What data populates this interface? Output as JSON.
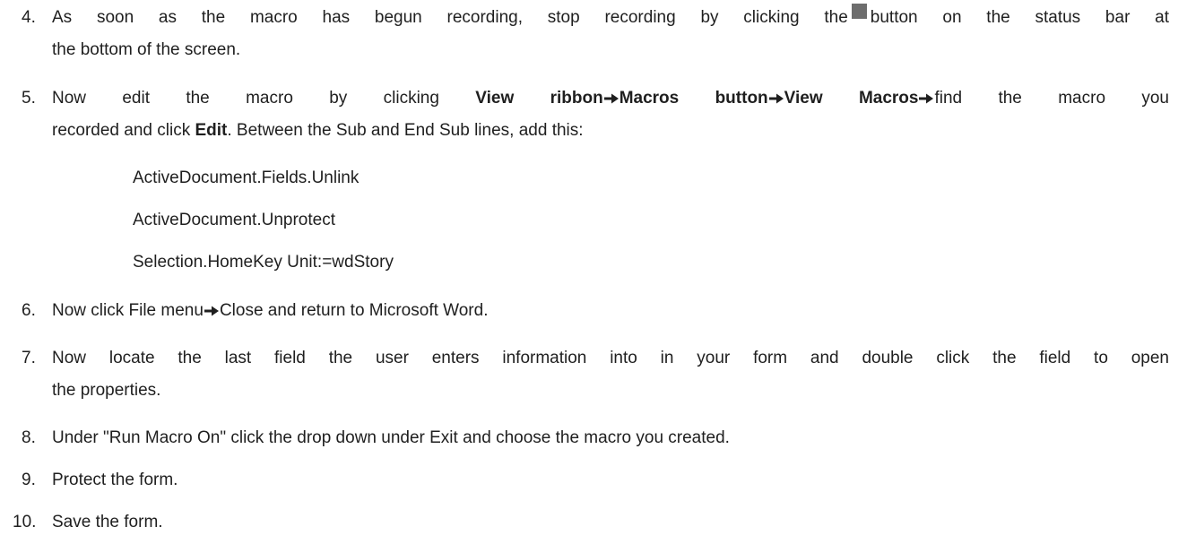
{
  "steps": [
    {
      "number": "4.",
      "line1_a": "As soon as the macro has begun recording, stop recording by clicking the",
      "icon": "stop-square-icon",
      "line1_b": "button on the status bar at",
      "line2": "the bottom of the screen."
    },
    {
      "number": "5.",
      "line1_a": "Now edit the macro by clicking",
      "bold1": "View ribbon",
      "bold2": "Macros button",
      "bold3": "View Macros",
      "line1_b": "find the macro you",
      "line2_a": "recorded and click",
      "bold4": "Edit",
      "line2_b": ". Between the Sub and End Sub lines, add this:",
      "code": [
        "ActiveDocument.Fields.Unlink",
        "ActiveDocument.Unprotect",
        "Selection.HomeKey Unit:=wdStory"
      ]
    },
    {
      "number": "6.",
      "text_a": "Now click File menu",
      "text_b": "Close and return to Microsoft Word."
    },
    {
      "number": "7.",
      "line1": "Now locate the last field the user enters information into in your form and double click the field to open",
      "line2": "the properties."
    },
    {
      "number": "8.",
      "text": "Under \"Run Macro On\" click the drop down under Exit and choose the macro you created."
    },
    {
      "number": "9.",
      "text": "Protect the form."
    },
    {
      "number": "10.",
      "text": "Save the form."
    }
  ],
  "colors": {
    "text": "#1f1f1f",
    "stop_icon": "#6d6d6d"
  }
}
